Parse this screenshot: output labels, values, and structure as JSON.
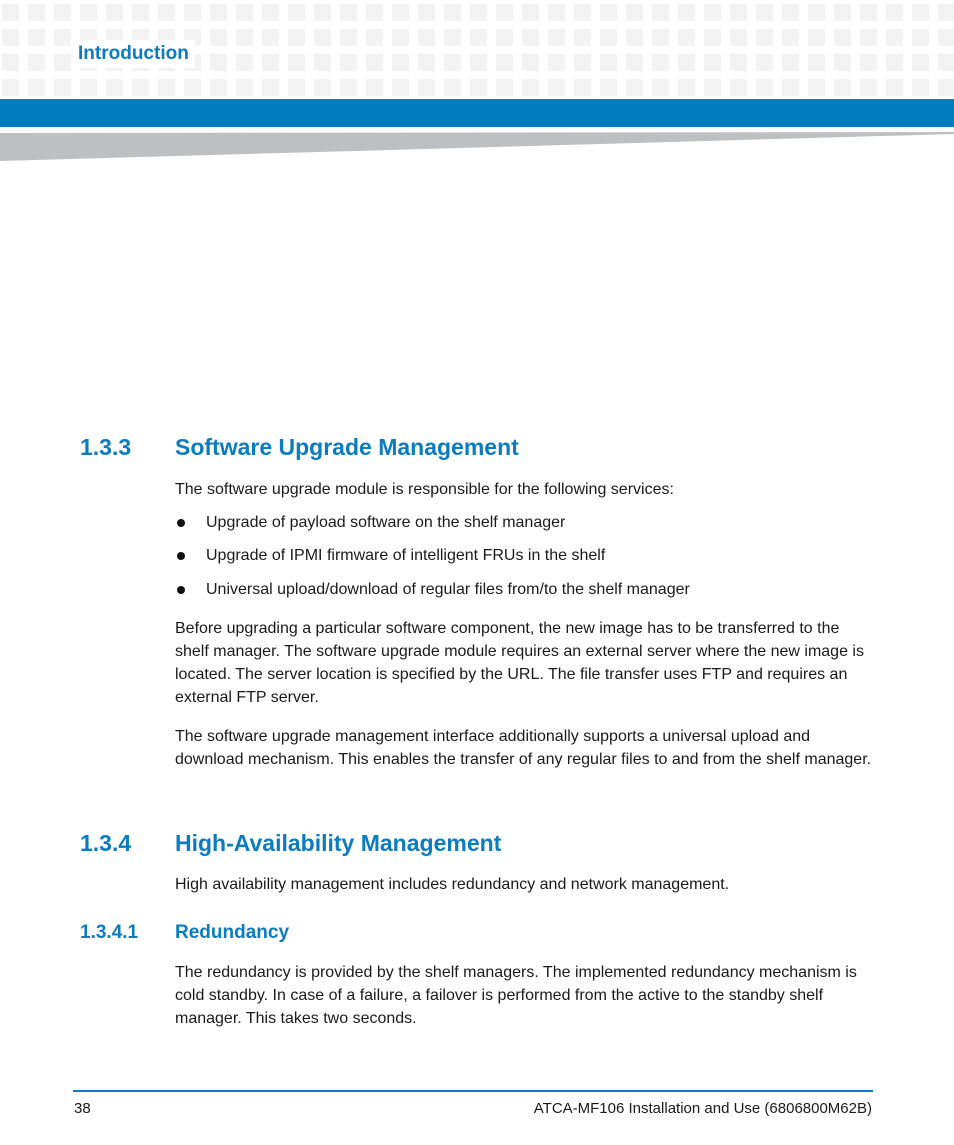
{
  "header": {
    "chapter": "Introduction",
    "colors": {
      "accent": "#017cbd",
      "heading": "#0a7cbf",
      "wedge": "#bebfc0",
      "tile": "#f3f3f3"
    }
  },
  "sections": [
    {
      "number": "1.3.3",
      "title": "Software Upgrade Management",
      "intro": "The software upgrade module is responsible for the following services:",
      "bullets": [
        "Upgrade of payload software on the shelf manager",
        "Upgrade of IPMI firmware of intelligent FRUs in the shelf",
        "Universal upload/download of regular files from/to the shelf manager"
      ],
      "paragraphs": [
        "Before upgrading a particular software component, the new image has to be transferred to the shelf manager. The software upgrade module requires an external server where the new image is located. The server location is specified by the URL. The file transfer uses FTP and requires an external FTP server.",
        "The software upgrade management interface additionally supports a universal upload and download mechanism. This enables the transfer of any regular files to and from the shelf manager."
      ]
    },
    {
      "number": "1.3.4",
      "title": "High-Availability Management",
      "intro": "High availability management includes redundancy and network management."
    },
    {
      "number": "1.3.4.1",
      "title": "Redundancy",
      "paragraphs": [
        "The redundancy is provided by the shelf managers. The implemented redundancy mechanism is cold standby. In case of a failure, a failover is performed from the active to the standby shelf manager. This takes two seconds."
      ]
    }
  ],
  "footer": {
    "page_number": "38",
    "document_title": "ATCA-MF106 Installation and Use (6806800M62B)"
  }
}
